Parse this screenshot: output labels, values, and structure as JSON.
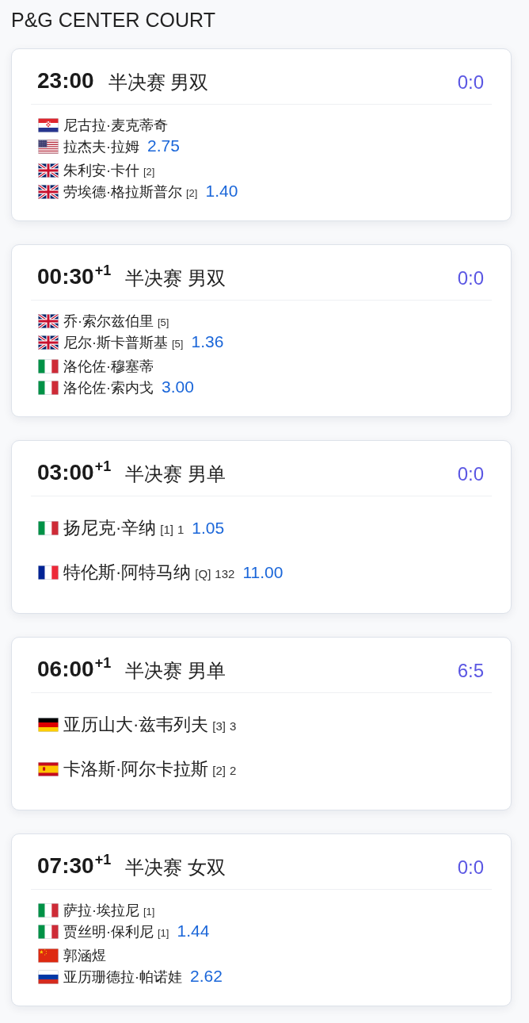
{
  "title": "P&G CENTER COURT",
  "matches": [
    {
      "kind": "doubles",
      "time": "23:00",
      "round": "半决赛 男双",
      "score": "0:0",
      "teams": [
        {
          "players": [
            {
              "flag": {
                "kind": "hr"
              },
              "name": "尼古拉·麦克蒂奇"
            },
            {
              "flag": {
                "kind": "us"
              },
              "name": "拉杰夫·拉姆"
            }
          ],
          "odds": "2.75"
        },
        {
          "players": [
            {
              "flag": {
                "kind": "gb"
              },
              "name": "朱利安·卡什",
              "seed": "[2]"
            },
            {
              "flag": {
                "kind": "gb"
              },
              "name": "劳埃德·格拉斯普尔",
              "seed": "[2]"
            }
          ],
          "odds": "1.40"
        }
      ]
    },
    {
      "kind": "doubles",
      "time": "00:30",
      "day_offset": "+1",
      "round": "半决赛 男双",
      "score": "0:0",
      "teams": [
        {
          "players": [
            {
              "flag": {
                "kind": "gb"
              },
              "name": "乔·索尔兹伯里",
              "seed": "[5]"
            },
            {
              "flag": {
                "kind": "gb"
              },
              "name": "尼尔·斯卡普斯基",
              "seed": "[5]"
            }
          ],
          "odds": "1.36"
        },
        {
          "players": [
            {
              "flag": {
                "kind": "it"
              },
              "name": "洛伦佐·穆塞蒂"
            },
            {
              "flag": {
                "kind": "it"
              },
              "name": "洛伦佐·索内戈"
            }
          ],
          "odds": "3.00"
        }
      ]
    },
    {
      "kind": "singles",
      "time": "03:00",
      "day_offset": "+1",
      "round": "半决赛 男单",
      "score": "0:0",
      "teams": [
        {
          "players": [
            {
              "flag": {
                "kind": "it"
              },
              "name": "扬尼克·辛纳",
              "seed": "[1]",
              "rank": "1"
            }
          ],
          "odds": "1.05"
        },
        {
          "players": [
            {
              "flag": {
                "kind": "fr"
              },
              "name": "特伦斯·阿特马纳",
              "seed": "[Q]",
              "rank": "132"
            }
          ],
          "odds": "11.00"
        }
      ]
    },
    {
      "kind": "singles",
      "time": "06:00",
      "day_offset": "+1",
      "round": "半决赛 男单",
      "score": "6:5",
      "teams": [
        {
          "players": [
            {
              "flag": {
                "kind": "de"
              },
              "name": "亚历山大·兹韦列夫",
              "seed": "[3]",
              "rank": "3"
            }
          ]
        },
        {
          "players": [
            {
              "flag": {
                "kind": "es"
              },
              "name": "卡洛斯·阿尔卡拉斯",
              "seed": "[2]",
              "rank": "2"
            }
          ]
        }
      ]
    },
    {
      "kind": "doubles",
      "time": "07:30",
      "day_offset": "+1",
      "round": "半决赛 女双",
      "score": "0:0",
      "teams": [
        {
          "players": [
            {
              "flag": {
                "kind": "it"
              },
              "name": "萨拉·埃拉尼",
              "seed": "[1]"
            },
            {
              "flag": {
                "kind": "it"
              },
              "name": "贾丝明·保利尼",
              "seed": "[1]"
            }
          ],
          "odds": "1.44"
        },
        {
          "players": [
            {
              "flag": {
                "kind": "cn"
              },
              "name": "郭涵煜"
            },
            {
              "flag": {
                "kind": "ru"
              },
              "name": "亚历珊德拉·帕诺娃"
            }
          ],
          "odds": "2.62"
        }
      ]
    }
  ]
}
